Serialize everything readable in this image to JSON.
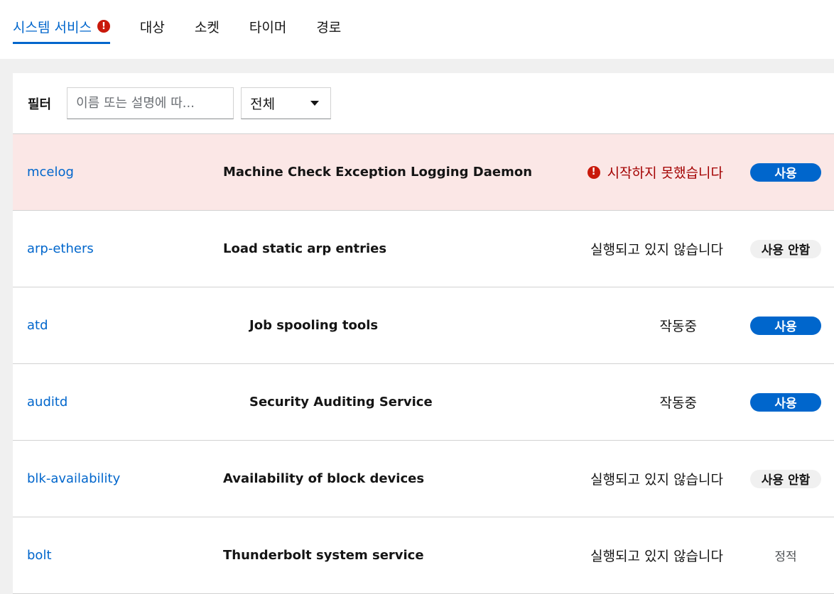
{
  "tabs": [
    {
      "label": "시스템 서비스"
    },
    {
      "label": "대상"
    },
    {
      "label": "소켓"
    },
    {
      "label": "타이머"
    },
    {
      "label": "경로"
    }
  ],
  "tab_error_icon": "!",
  "filter": {
    "label": "필터",
    "placeholder": "이름 또는 설명에 따...",
    "select_value": "전체"
  },
  "rows": [
    {
      "name": "mcelog",
      "description": "Machine Check Exception Logging Daemon",
      "state": "시작하지 못했습니다",
      "state_icon": "!",
      "badge": "사용"
    },
    {
      "name": "arp-ethers",
      "description": "Load static arp entries",
      "state": "실행되고 있지 않습니다",
      "badge": "사용 안함"
    },
    {
      "name": "atd",
      "description": "Job spooling tools",
      "state": "작동중",
      "badge": "사용"
    },
    {
      "name": "auditd",
      "description": "Security Auditing Service",
      "state": "작동중",
      "badge": "사용"
    },
    {
      "name": "blk-availability",
      "description": "Availability of block devices",
      "state": "실행되고 있지 않습니다",
      "badge": "사용 안함"
    },
    {
      "name": "bolt",
      "description": "Thunderbolt system service",
      "state": "실행되고 있지 않습니다",
      "badge": "정적"
    }
  ],
  "colors": {
    "accent": "#0066cc",
    "error": "#c9190b",
    "failed_row_bg": "#fbe7e6"
  }
}
